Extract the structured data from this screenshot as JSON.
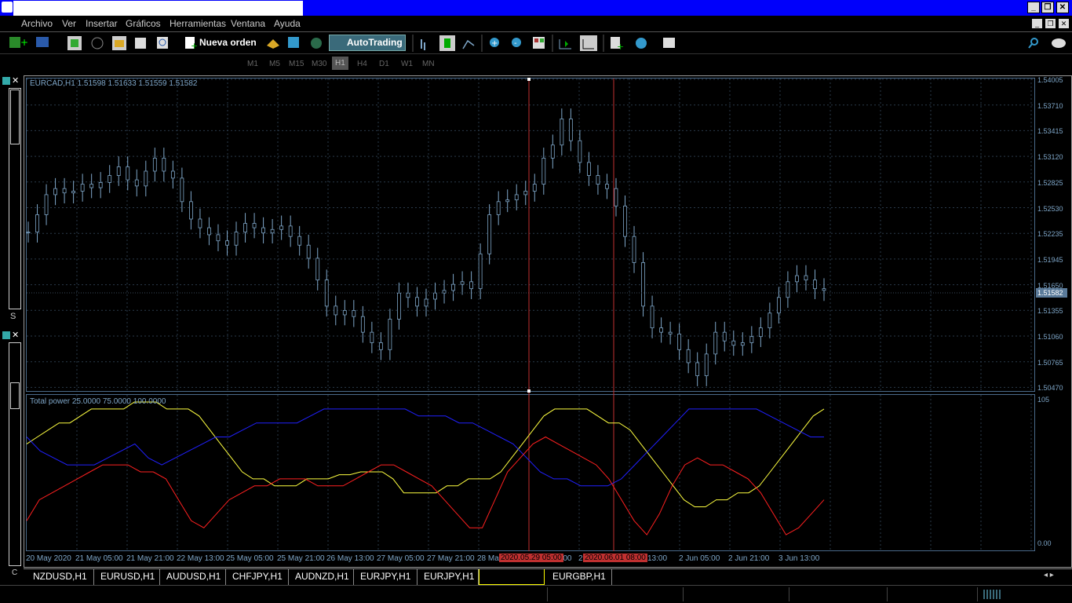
{
  "menu": {
    "items": [
      "Archivo",
      "Ver",
      "Insertar",
      "Gráficos",
      "Herramientas",
      "Ventana",
      "Ayuda"
    ]
  },
  "toolbar": {
    "new_order_label": "Nueva orden",
    "autotrading_label": "AutoTrading",
    "timeframes": [
      "M1",
      "M5",
      "M15",
      "M30",
      "H1",
      "H4",
      "D1",
      "W1",
      "MN"
    ],
    "active_timeframe": "H1"
  },
  "chart": {
    "header": "EURCAD,H1  1.51598  1.51633  1.51559  1.51582",
    "current_price": "1.51582",
    "price_ticks": [
      "1.54005",
      "1.53710",
      "1.53415",
      "1.53120",
      "1.52825",
      "1.52530",
      "1.52235",
      "1.51945",
      "1.51650",
      "1.51355",
      "1.51060",
      "1.50765",
      "1.50470"
    ],
    "time_labels": [
      "20 May 2020",
      "21 May 05:00",
      "21 May 21:00",
      "22 May 13:00",
      "25 May 05:00",
      "25 May 21:00",
      "26 May 13:00",
      "27 May 05:00",
      "27 May 21:00",
      "28 Ma",
      "5:00",
      "2",
      "13:00",
      "2 Jun 05:00",
      "2 Jun 21:00",
      "3 Jun 13:00"
    ],
    "marked_times": [
      "2020.05.29 05:00",
      "2020.06.01 08:00"
    ]
  },
  "indicator": {
    "header": "Total power 25.0000 75.0000 100.0000",
    "axis_top": "105",
    "axis_bottom": "0.00"
  },
  "colors": {
    "blue_line": "#2020ff",
    "yellow_line": "#ffff40",
    "red_line": "#ff2020",
    "candles": "#7ea6c8",
    "grid": "#2a3a4a"
  },
  "chart_data": {
    "type": "line",
    "price": {
      "ylim": [
        1.5047,
        1.54005
      ],
      "close": [
        1.5225,
        1.5245,
        1.5268,
        1.5275,
        1.527,
        1.5272,
        1.528,
        1.5276,
        1.5282,
        1.529,
        1.53,
        1.5285,
        1.5278,
        1.5295,
        1.531,
        1.5295,
        1.5287,
        1.526,
        1.524,
        1.523,
        1.5222,
        1.5215,
        1.521,
        1.5225,
        1.5235,
        1.523,
        1.5224,
        1.5228,
        1.5232,
        1.522,
        1.521,
        1.5195,
        1.517,
        1.514,
        1.513,
        1.5135,
        1.5128,
        1.511,
        1.5098,
        1.509,
        1.5125,
        1.5155,
        1.515,
        1.514,
        1.5148,
        1.5155,
        1.5158,
        1.5165,
        1.5168,
        1.516,
        1.52,
        1.5245,
        1.526,
        1.5262,
        1.5268,
        1.5272,
        1.528,
        1.531,
        1.5325,
        1.5355,
        1.533,
        1.5305,
        1.529,
        1.528,
        1.5275,
        1.5255,
        1.522,
        1.519,
        1.514,
        1.5115,
        1.511,
        1.5108,
        1.509,
        1.5075,
        1.506,
        1.5085,
        1.511,
        1.51,
        1.5095,
        1.5098,
        1.5105,
        1.5115,
        1.5132,
        1.515,
        1.5168,
        1.5175,
        1.517,
        1.516,
        1.5158
      ]
    },
    "series": [
      {
        "name": "",
        "values": [
          70,
          75,
          80,
          85,
          85,
          90,
          95,
          95,
          95,
          95,
          100,
          100,
          100,
          95,
          95,
          95,
          90,
          80,
          70,
          60,
          50,
          45,
          45,
          40,
          40,
          40,
          45,
          45,
          45,
          48,
          48,
          50,
          50,
          50,
          45,
          35,
          35,
          35,
          35,
          40,
          40,
          45,
          45,
          45,
          50,
          60,
          70,
          80,
          90,
          95,
          95,
          95,
          95,
          90,
          85,
          85,
          80,
          70,
          60,
          50,
          40,
          30,
          25,
          25,
          30,
          30,
          35,
          35,
          40,
          50,
          60,
          70,
          80,
          90,
          95
        ]
      },
      {
        "name": "",
        "values": [
          75,
          65,
          60,
          55,
          55,
          55,
          60,
          65,
          70,
          60,
          55,
          60,
          65,
          70,
          75,
          75,
          80,
          85,
          85,
          85,
          85,
          90,
          95,
          95,
          95,
          95,
          95,
          95,
          95,
          90,
          90,
          90,
          85,
          85,
          80,
          75,
          70,
          60,
          50,
          45,
          45,
          40,
          40,
          40,
          45,
          55,
          65,
          75,
          85,
          95,
          95,
          95,
          95,
          95,
          95,
          90,
          85,
          80,
          75,
          75
        ]
      },
      {
        "name": "",
        "values": [
          15,
          30,
          35,
          40,
          45,
          50,
          55,
          55,
          55,
          50,
          50,
          45,
          30,
          15,
          10,
          20,
          30,
          35,
          40,
          40,
          45,
          45,
          45,
          40,
          40,
          40,
          45,
          50,
          55,
          55,
          50,
          45,
          40,
          30,
          20,
          10,
          10,
          30,
          50,
          60,
          70,
          75,
          70,
          65,
          60,
          55,
          45,
          30,
          15,
          5,
          20,
          40,
          55,
          60,
          55,
          55,
          50,
          45,
          35,
          20,
          5,
          10,
          20,
          30
        ]
      }
    ]
  },
  "tabs": {
    "items": [
      "NZDUSD,H1",
      "EURUSD,H1",
      "AUDUSD,H1",
      "CHFJPY,H1",
      "AUDNZD,H1",
      "EURJPY,H1",
      "EURJPY,H1",
      "",
      "EURGBP,H1"
    ],
    "active_index": 7
  }
}
